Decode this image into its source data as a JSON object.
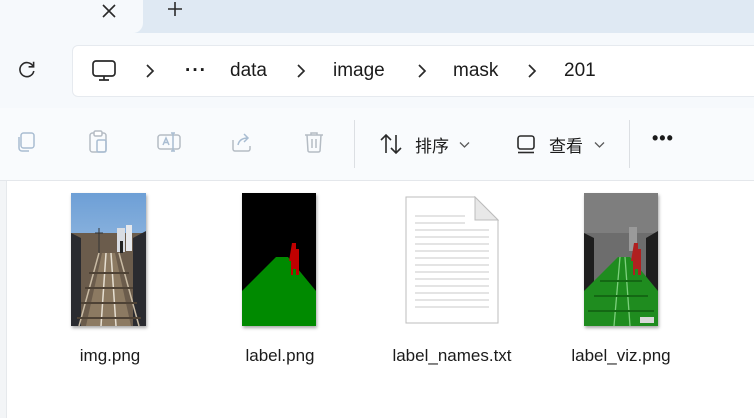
{
  "tabs": {
    "close_icon": "close-icon",
    "new_tab_icon": "plus-icon"
  },
  "address": {
    "refresh_icon": "refresh-icon",
    "root_icon": "computer-icon",
    "overflow": "···",
    "breadcrumbs": [
      "data",
      "image",
      "mask",
      "201"
    ]
  },
  "toolbar": {
    "copy_icon": "copy-icon",
    "paste_icon": "paste-icon",
    "rename_icon": "rename-icon",
    "share_icon": "share-icon",
    "delete_icon": "trash-icon",
    "sort_label": "排序",
    "view_label": "查看",
    "more_label": "•••"
  },
  "files": [
    {
      "name": "img.png",
      "type": "image-photo"
    },
    {
      "name": "label.png",
      "type": "image-mask"
    },
    {
      "name": "label_names.txt",
      "type": "text-document"
    },
    {
      "name": "label_viz.png",
      "type": "image-overlay"
    }
  ],
  "colors": {
    "accent_bg": "#dfe9f3",
    "mask_green": "#008a00",
    "mask_red": "#c00000"
  }
}
